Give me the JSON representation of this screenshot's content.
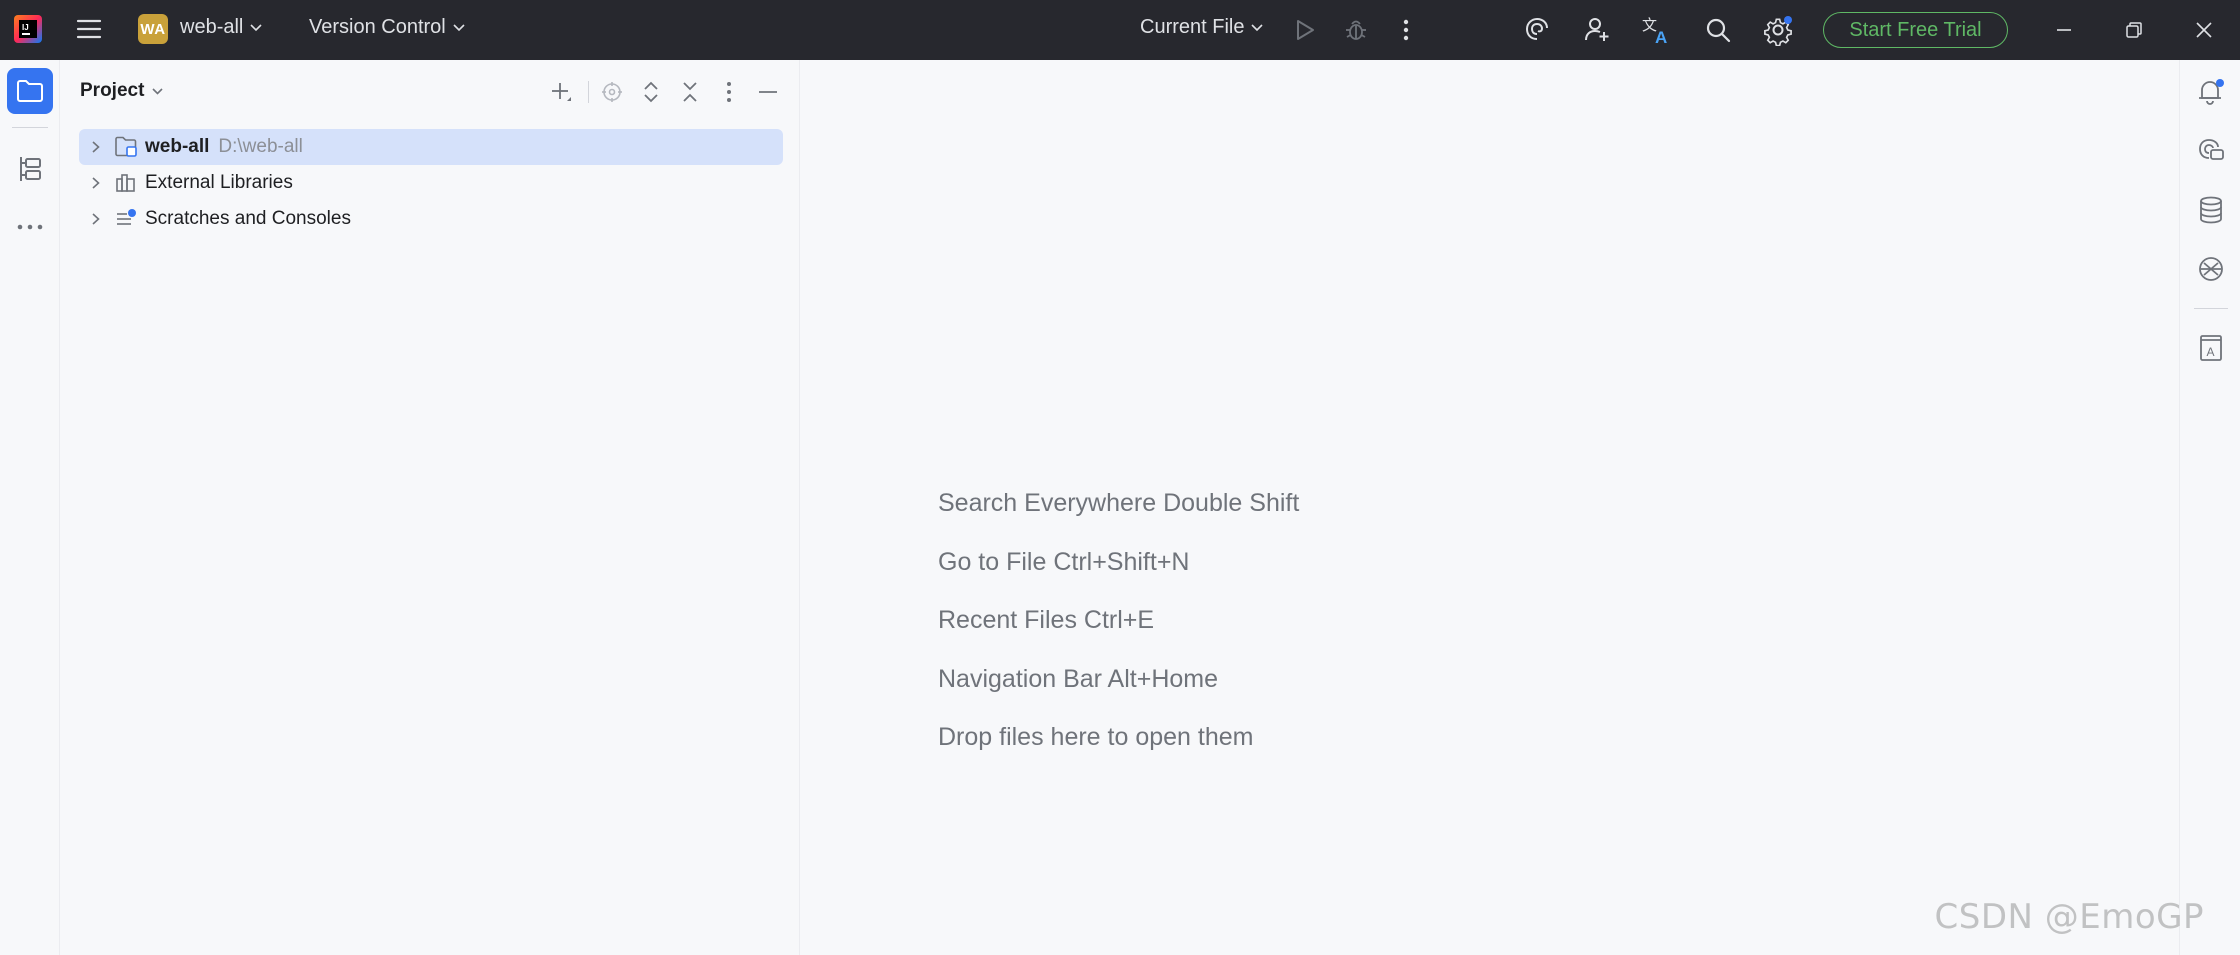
{
  "titlebar": {
    "project_badge": "WA",
    "project_name": "web-all",
    "vcs_label": "Version Control",
    "run_config": "Current File",
    "trial_button": "Start Free Trial"
  },
  "icons": {
    "app": "intellij-idea-icon",
    "menu": "hamburger-menu-icon",
    "run": "run-icon",
    "debug": "debug-icon",
    "more": "more-vertical-icon",
    "ai": "ai-assistant-icon",
    "add_user": "code-with-me-icon",
    "translate": "translate-icon",
    "search": "search-icon",
    "settings": "settings-icon",
    "notifications": "notifications-icon",
    "ai_chat": "ai-chat-icon",
    "database": "database-icon",
    "copilot": "copilot-icon",
    "book": "book-icon"
  },
  "colors": {
    "accent": "#3574f0",
    "trial": "#5fb865",
    "titlebar_bg": "#27282e",
    "selection": "#d5e1fa"
  },
  "project_panel": {
    "title": "Project",
    "tree": [
      {
        "label": "web-all",
        "path": "D:\\web-all",
        "icon": "module-folder-icon",
        "selected": true
      },
      {
        "label": "External Libraries",
        "path": "",
        "icon": "libraries-icon",
        "selected": false
      },
      {
        "label": "Scratches and Consoles",
        "path": "",
        "icon": "scratches-icon",
        "selected": false
      }
    ]
  },
  "editor": {
    "hints": [
      "Search Everywhere Double Shift",
      "Go to File Ctrl+Shift+N",
      "Recent Files Ctrl+E",
      "Navigation Bar Alt+Home",
      "Drop files here to open them"
    ]
  },
  "watermark": "CSDN @EmoGP"
}
